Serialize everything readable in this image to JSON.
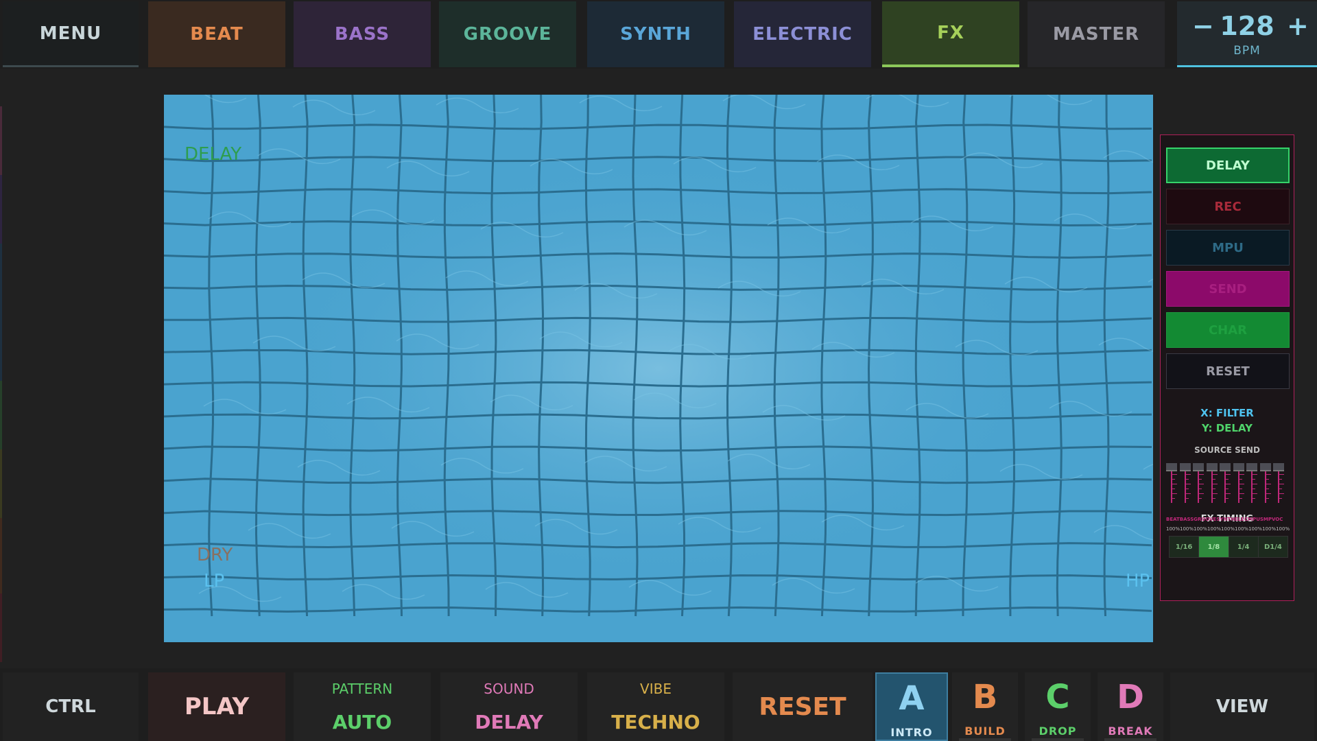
{
  "topbar": {
    "menu": "MENU",
    "tabs": [
      {
        "label": "BEAT",
        "color": "#e48a4e"
      },
      {
        "label": "BASS",
        "color": "#9b73c9"
      },
      {
        "label": "GROOVE",
        "color": "#5cb59a"
      },
      {
        "label": "SYNTH",
        "color": "#5aa6d8"
      },
      {
        "label": "ELECTRIC",
        "color": "#8c8fd6"
      },
      {
        "label": "FX",
        "color": "#a6d05a",
        "active": true
      },
      {
        "label": "MASTER",
        "color": "#9a9aa4"
      }
    ],
    "bpm": {
      "minus": "−",
      "value": "128",
      "plus": "+",
      "unit": "BPM"
    }
  },
  "pad": {
    "label_top": "DELAY",
    "label_bottom": "DRY",
    "label_left": "LP",
    "label_right": "HP",
    "colors": {
      "top": "#2e9d4e",
      "bottom": "#8a7060",
      "sides": "#5bc1ee"
    }
  },
  "fx": {
    "buttons": [
      {
        "label": "DELAY",
        "state": "active"
      },
      {
        "label": "REC"
      },
      {
        "label": "MPU"
      },
      {
        "label": "SEND"
      },
      {
        "label": "CHAR"
      },
      {
        "label": "RESET"
      }
    ],
    "x_axis": "X: FILTER",
    "y_axis": "Y: DELAY",
    "source_send_title": "SOURCE SEND",
    "send_names": "BEATBASSGROOVESYNTHELECMPUSMPVOC",
    "send_values": "100%100%100%100%100%100%100%100%100%",
    "timing_title": "FX TIMING",
    "timing": [
      {
        "label": "1/16"
      },
      {
        "label": "1/8",
        "active": true
      },
      {
        "label": "1/4"
      },
      {
        "label": "D1/4"
      }
    ]
  },
  "bottombar": {
    "ctrl": "CTRL",
    "play": "PLAY",
    "pattern": {
      "title": "PATTERN",
      "value": "AUTO"
    },
    "sound": {
      "title": "SOUND",
      "value": "DELAY"
    },
    "vibe": {
      "title": "VIBE",
      "value": "TECHNO"
    },
    "reset": "RESET",
    "scenes": [
      {
        "letter": "A",
        "name": "INTRO",
        "color": "#8fd1f0",
        "active": true
      },
      {
        "letter": "B",
        "name": "BUILD",
        "color": "#e48a4e"
      },
      {
        "letter": "C",
        "name": "DROP",
        "color": "#5ccf6a"
      },
      {
        "letter": "D",
        "name": "BREAK",
        "color": "#e07ab8"
      }
    ],
    "view": "VIEW"
  }
}
